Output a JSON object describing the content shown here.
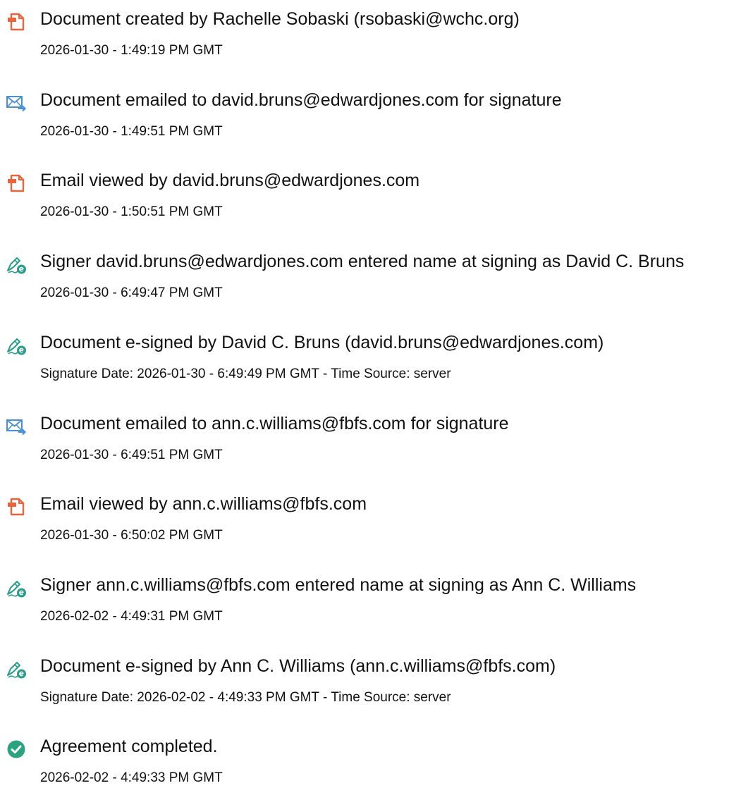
{
  "colors": {
    "document_icon": "#e8643c",
    "email_icon": "#4a90d9",
    "sign_icon": "#2c9c8a",
    "complete_icon": "#2aa37e"
  },
  "events": [
    {
      "icon": "document-icon",
      "title": "Document created by Rachelle Sobaski (rsobaski@wchc.org)",
      "subtitle": "2026-01-30 - 1:49:19 PM GMT"
    },
    {
      "icon": "email-icon",
      "title": "Document emailed to david.bruns@edwardjones.com for signature",
      "subtitle": "2026-01-30 - 1:49:51 PM GMT"
    },
    {
      "icon": "document-icon",
      "title": "Email viewed by david.bruns@edwardjones.com",
      "subtitle": "2026-01-30 - 1:50:51 PM GMT"
    },
    {
      "icon": "signer-icon",
      "title": "Signer david.bruns@edwardjones.com entered name at signing as David C. Bruns",
      "subtitle": "2026-01-30 - 6:49:47 PM GMT"
    },
    {
      "icon": "signer-icon",
      "title": "Document e-signed by David C. Bruns (david.bruns@edwardjones.com)",
      "subtitle": "Signature Date: 2026-01-30 - 6:49:49 PM GMT - Time Source: server"
    },
    {
      "icon": "email-icon",
      "title": "Document emailed to ann.c.williams@fbfs.com for signature",
      "subtitle": "2026-01-30 - 6:49:51 PM GMT"
    },
    {
      "icon": "document-icon",
      "title": "Email viewed by ann.c.williams@fbfs.com",
      "subtitle": "2026-01-30 - 6:50:02 PM GMT"
    },
    {
      "icon": "signer-icon",
      "title": "Signer ann.c.williams@fbfs.com entered name at signing as Ann C. Williams",
      "subtitle": "2026-02-02 - 4:49:31 PM GMT"
    },
    {
      "icon": "signer-icon",
      "title": "Document e-signed by Ann C. Williams (ann.c.williams@fbfs.com)",
      "subtitle": "Signature Date: 2026-02-02 - 4:49:33 PM GMT - Time Source: server"
    },
    {
      "icon": "check-circle-icon",
      "title": "Agreement completed.",
      "subtitle": "2026-02-02 - 4:49:33 PM GMT"
    }
  ]
}
